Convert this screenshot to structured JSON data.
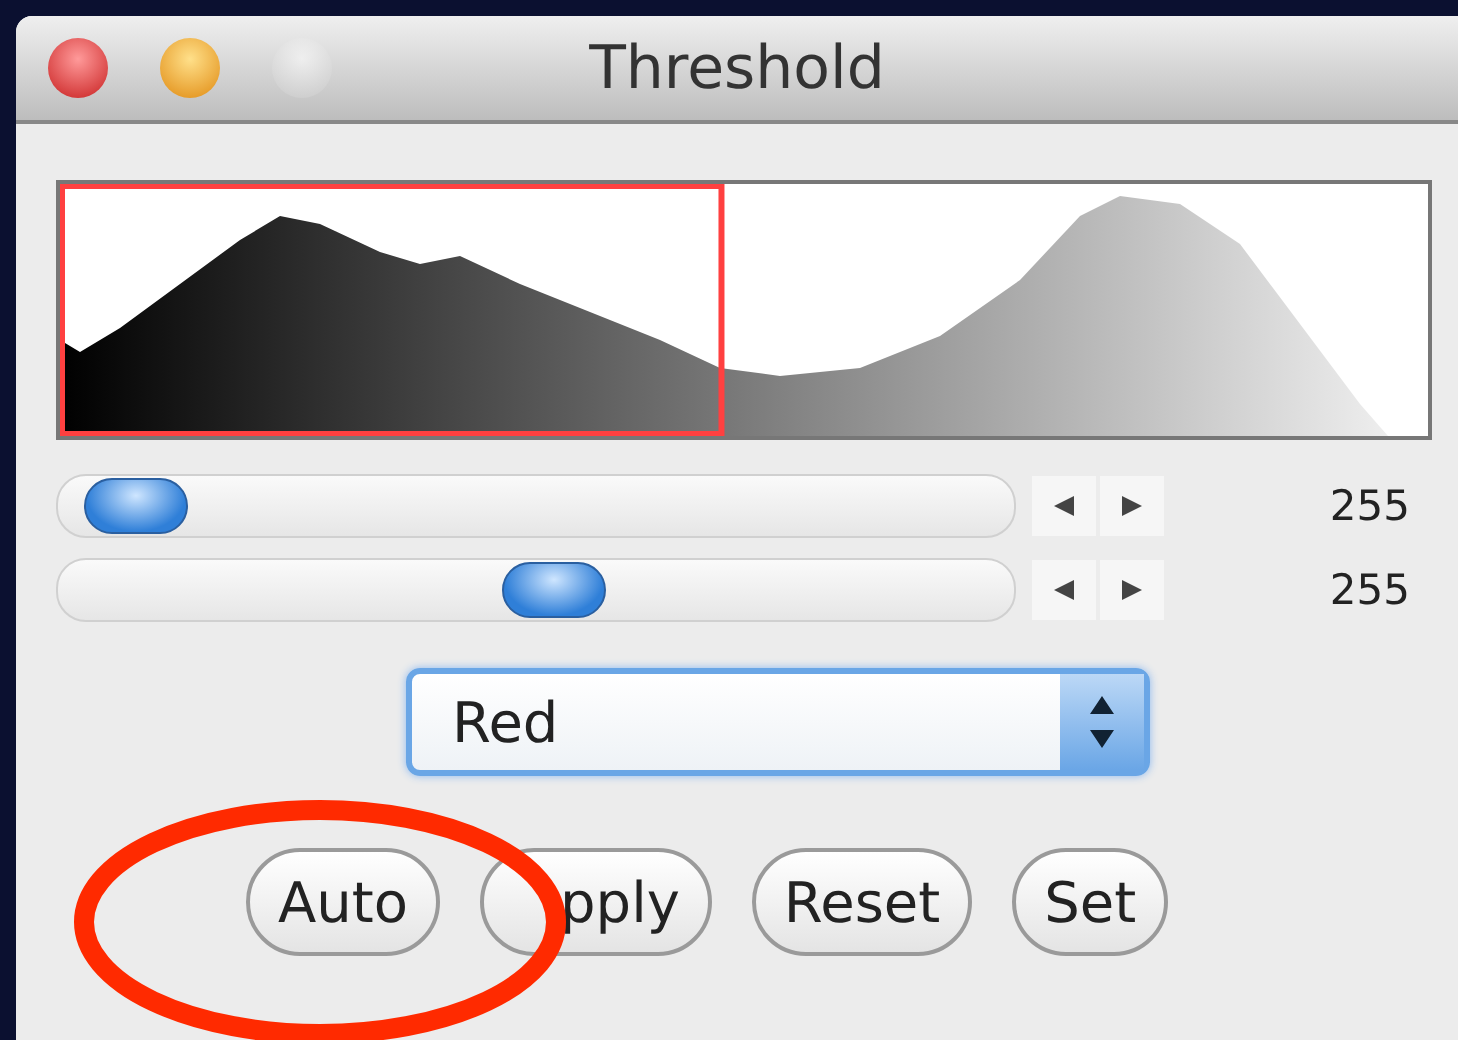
{
  "window": {
    "title": "Threshold",
    "buttons": [
      {
        "kind": "close",
        "disabled": false
      },
      {
        "kind": "minimize",
        "disabled": false
      },
      {
        "kind": "zoom",
        "disabled": true
      }
    ]
  },
  "histogram": {
    "threshold": {
      "level": 0.485
    }
  },
  "sliders": [
    {
      "level": 0.03,
      "reading": "255"
    },
    {
      "level": 0.52,
      "reading": "255"
    }
  ],
  "channel_select": {
    "value": "Red"
  },
  "buttons": [
    "Auto",
    "pply",
    "Reset",
    "Set"
  ],
  "annotation": {
    "kind": "ellipse"
  }
}
